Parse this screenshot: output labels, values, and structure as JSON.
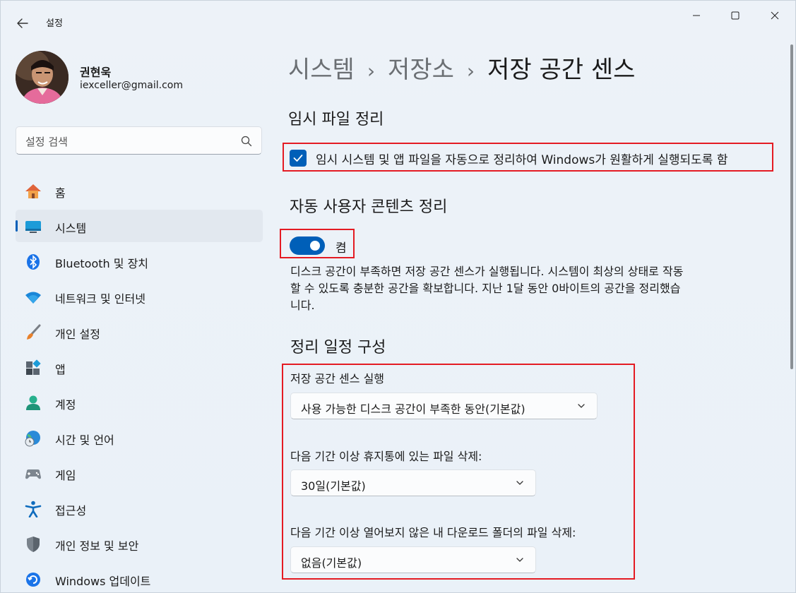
{
  "window": {
    "title": "설정",
    "controls": {
      "minimize": "minimize-icon",
      "maximize": "maximize-icon",
      "close": "close-icon"
    }
  },
  "profile": {
    "name": "권현욱",
    "email": "iexceller@gmail.com"
  },
  "search": {
    "placeholder": "설정 검색"
  },
  "sidebar": {
    "items": [
      {
        "label": "홈",
        "icon": "home-icon",
        "selected": false
      },
      {
        "label": "시스템",
        "icon": "system-icon",
        "selected": true
      },
      {
        "label": "Bluetooth 및 장치",
        "icon": "bluetooth-icon",
        "selected": false
      },
      {
        "label": "네트워크 및 인터넷",
        "icon": "wifi-icon",
        "selected": false
      },
      {
        "label": "개인 설정",
        "icon": "brush-icon",
        "selected": false
      },
      {
        "label": "앱",
        "icon": "apps-icon",
        "selected": false
      },
      {
        "label": "계정",
        "icon": "account-icon",
        "selected": false
      },
      {
        "label": "시간 및 언어",
        "icon": "globe-clock-icon",
        "selected": false
      },
      {
        "label": "게임",
        "icon": "gamepad-icon",
        "selected": false
      },
      {
        "label": "접근성",
        "icon": "accessibility-icon",
        "selected": false
      },
      {
        "label": "개인 정보 및 보안",
        "icon": "shield-icon",
        "selected": false
      },
      {
        "label": "Windows 업데이트",
        "icon": "update-icon",
        "selected": false
      }
    ]
  },
  "breadcrumb": {
    "items": [
      "시스템",
      "저장소",
      "저장 공간 센스"
    ],
    "separator": "›"
  },
  "main": {
    "temp_section_title": "임시 파일 정리",
    "temp_checkbox_label": "임시 시스템 및 앱 파일을 자동으로 정리하여 Windows가 원활하게 실행되도록 함",
    "temp_checkbox_checked": true,
    "auto_section_title": "자동 사용자 콘텐츠 정리",
    "toggle_state": "켬",
    "toggle_on": true,
    "description": "디스크 공간이 부족하면 저장 공간 센스가 실행됩니다. 시스템이 최상의 상태로 작동할 수 있도록 충분한 공간을 확보합니다. 지난 1달 동안 0바이트의 공간을 정리했습니다.",
    "schedule_section_title": "정리 일정 구성",
    "run_label": "저장 공간 센스 실행",
    "run_value": "사용 가능한 디스크 공간이 부족한 동안(기본값)",
    "recycle_label": "다음 기간 이상 휴지통에 있는 파일 삭제:",
    "recycle_value": "30일(기본값)",
    "downloads_label": "다음 기간 이상 열어보지 않은 내 다운로드 폴더의 파일 삭제:",
    "downloads_value": "없음(기본값)"
  },
  "colors": {
    "accent": "#005fb8",
    "highlight_box": "#e41b23",
    "background": "#eef3f9"
  }
}
